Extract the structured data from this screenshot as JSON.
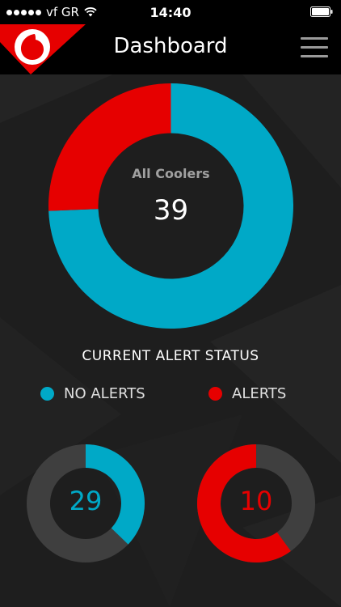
{
  "status_bar": {
    "carrier": "vf GR",
    "time": "14:40"
  },
  "navbar": {
    "title": "Dashboard"
  },
  "colors": {
    "no_alerts": "#00a9c7",
    "alerts": "#e60000",
    "remainder_ring": "#3f3f3f",
    "background": "#1e1e1e"
  },
  "summary": {
    "label": "All Coolers",
    "total": "39"
  },
  "alert_status": {
    "heading": "CURRENT ALERT STATUS",
    "legend": {
      "no_alerts": "NO ALERTS",
      "alerts": "ALERTS"
    },
    "no_alerts_count": "29",
    "alerts_count": "10"
  },
  "chart_data": {
    "type": "pie",
    "categories": [
      "NO ALERTS",
      "ALERTS"
    ],
    "values": [
      29,
      10
    ]
  }
}
